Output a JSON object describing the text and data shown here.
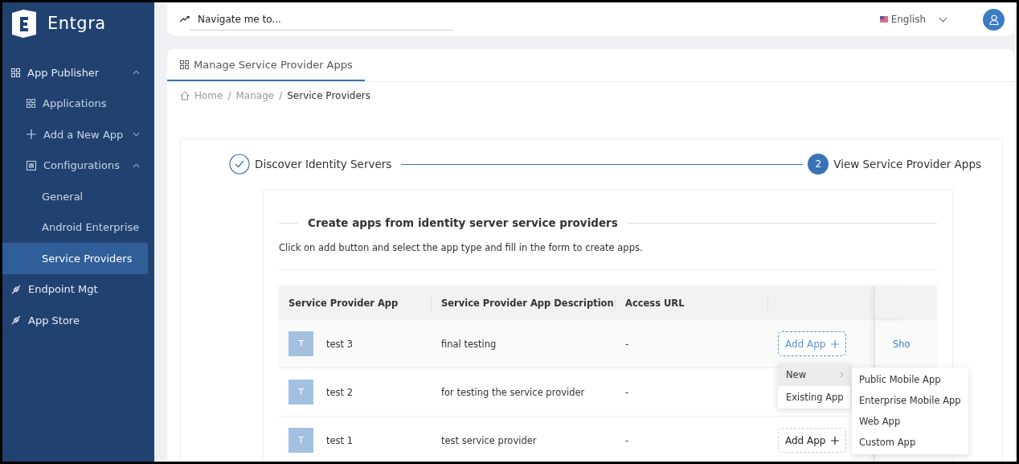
{
  "brand": {
    "name": "Entgra"
  },
  "sidebar": {
    "items": [
      {
        "label": "App Publisher",
        "kind": "grid",
        "expanded": true,
        "selected": false,
        "children": [
          {
            "label": "Applications",
            "kind": "grid",
            "selected": false
          },
          {
            "label": "Add a New App",
            "kind": "plus",
            "expanded": false,
            "selected": false
          },
          {
            "label": "Configurations",
            "kind": "sliders",
            "expanded": true,
            "selected": false,
            "children": [
              {
                "label": "General",
                "selected": false
              },
              {
                "label": "Android Enterprise",
                "selected": false
              },
              {
                "label": "Service Providers",
                "selected": true
              }
            ]
          }
        ]
      },
      {
        "label": "Endpoint Mgt",
        "kind": "link",
        "selected": false
      },
      {
        "label": "App Store",
        "kind": "link",
        "selected": false
      }
    ]
  },
  "topbar": {
    "search": {
      "placeholder": "Navigate me to..."
    },
    "language": "English"
  },
  "page_tab": {
    "label": "Manage Service Provider Apps",
    "selected": true
  },
  "breadcrumb": {
    "items": [
      "Home",
      "Manage",
      "Service Providers"
    ],
    "separator": "/"
  },
  "steps": [
    {
      "label": "Discover Identity Servers",
      "done": true
    },
    {
      "number": "2",
      "label": "View Service Provider Apps",
      "done": false
    }
  ],
  "section": {
    "title": "Create apps from identity server service providers",
    "description": "Click on add button and select the app type and fill in the form to create apps."
  },
  "table": {
    "columns": [
      "Service Provider App",
      "Service Provider App Description",
      "Access URL"
    ],
    "rows": [
      {
        "avatar": "T",
        "name": "test 3",
        "description": "final testing",
        "url": "-",
        "add_button": {
          "label": "Add App",
          "active": true
        },
        "link": "Sho"
      },
      {
        "avatar": "T",
        "name": "test 2",
        "description": "for testing the service provider",
        "url": "-"
      },
      {
        "avatar": "T",
        "name": "test 1",
        "description": "test service provider",
        "url": "-",
        "add_button": {
          "label": "Add App",
          "active": false
        }
      }
    ]
  },
  "dropdown": {
    "items": [
      {
        "label": "New",
        "submenu": true,
        "selected": true
      },
      {
        "label": "Existing App",
        "submenu": false,
        "selected": false
      }
    ],
    "submenu": [
      "Public Mobile App",
      "Enterprise Mobile App",
      "Web App",
      "Custom App"
    ]
  }
}
